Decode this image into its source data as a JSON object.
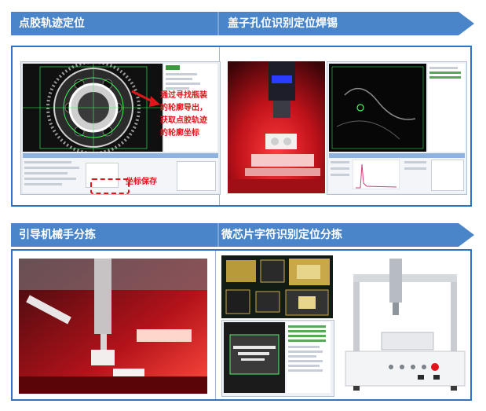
{
  "banners": [
    {
      "title": "点胶轨迹定位"
    },
    {
      "title": "盖子孔位识别定位焊锡"
    },
    {
      "title": "引导机械手分拣"
    },
    {
      "title": "微芯片字符识别定位分拣"
    }
  ],
  "annotations": {
    "contour_note": [
      "通过寻找瓶装",
      "的轮廓导出，",
      "获取点胶轨迹",
      "的轮廓坐标"
    ],
    "save_note": "坐标保存"
  },
  "colors": {
    "banner_blue": "#4a85c9",
    "panel_border": "#2e73c4",
    "annotation_red": "#e0161b"
  }
}
